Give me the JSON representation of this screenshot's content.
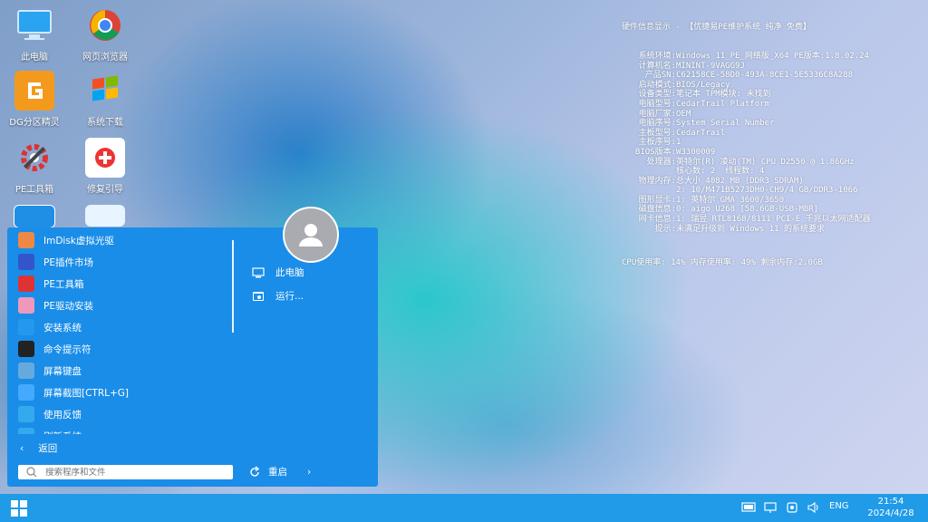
{
  "desktop": {
    "icons": [
      {
        "label": "此电脑",
        "icon": "computer-icon"
      },
      {
        "label": "网页浏览器",
        "icon": "browser-icon"
      },
      {
        "label": "DG分区精灵",
        "icon": "partition-tool-icon"
      },
      {
        "label": "系统下载",
        "icon": "windows-download-icon"
      },
      {
        "label": "PE工具箱",
        "icon": "toolbox-icon"
      },
      {
        "label": "修复引导",
        "icon": "repair-boot-icon"
      }
    ]
  },
  "hw_info": {
    "title": "硬件信息显示 - 【优捷易PE维护系统 纯净 免费】",
    "rows": [
      {
        "k": "系统环境:",
        "v": "Windows 11_PE_网络版_X64 PE版本:1.8.02.24"
      },
      {
        "k": "计算机名:",
        "v": "MININT-9VAGG9J"
      },
      {
        "k": "产品SN:",
        "v": "C62158CE-58D0-493A-8CE1-5E5336C8A288"
      },
      {
        "k": "启动模式:",
        "v": "BIOS/Legacy"
      },
      {
        "k": "设备类型:",
        "v": "笔记本 TPM模块: 未找到"
      },
      {
        "k": "电脑型号:",
        "v": "CedarTrail Platform"
      },
      {
        "k": "电脑厂家:",
        "v": "OEM"
      },
      {
        "k": "电脑序号:",
        "v": "System Serial Number"
      },
      {
        "k": "主板型号:",
        "v": "CedarTrail"
      },
      {
        "k": "主板序号:",
        "v": "1"
      },
      {
        "k": "BIOS版本:",
        "v": "W3300009"
      },
      {
        "k": "处理器:",
        "v": "英特尔(R) 凌动(TM) CPU D2550 @ 1.86GHz"
      },
      {
        "k": "",
        "v": "核心数: 2  线程数: 4"
      },
      {
        "k": "物理内存:",
        "v": "总大小 4082 MB (DDR3 SDRAM)"
      },
      {
        "k": "",
        "v": "2: 10/M471B5273DH0-CH9/4 GB/DDR3-1066"
      },
      {
        "k": "图形显卡:",
        "v": "1: 英特尔 GMA 3600/3650"
      },
      {
        "k": "磁盘信息:",
        "v": "0: aigo U268 [58.6GB-USB-MBR]"
      },
      {
        "k": "网卡信息:",
        "v": "1: 瑞昱 RTL8168/8111 PCI-E 千兆以太网适配器"
      },
      {
        "k": "提示:",
        "v": "未满足升级到 Windows 11 的系统要求"
      }
    ],
    "usage": "CPU使用率: 14% 内存使用率: 49% 剩余内存:2.0GB"
  },
  "start_menu": {
    "apps": [
      {
        "label": "ImDisk虚拟光驱",
        "icon": "imdisk-icon"
      },
      {
        "label": "PE插件市场",
        "icon": "plugin-market-icon"
      },
      {
        "label": "PE工具箱",
        "icon": "toolbox-icon"
      },
      {
        "label": "PE驱动安装",
        "icon": "driver-install-icon"
      },
      {
        "label": "安装系统",
        "icon": "install-system-icon"
      },
      {
        "label": "命令提示符",
        "icon": "cmd-icon"
      },
      {
        "label": "屏幕键盘",
        "icon": "keyboard-icon"
      },
      {
        "label": "屏幕截图[CTRL+G]",
        "icon": "screenshot-icon"
      },
      {
        "label": "使用反馈",
        "icon": "feedback-icon"
      },
      {
        "label": "刷新系统",
        "icon": "refresh-icon"
      }
    ],
    "right_links": [
      {
        "label": "此电脑",
        "icon": "computer-icon"
      },
      {
        "label": "运行...",
        "icon": "run-icon"
      }
    ],
    "back_label": "返回",
    "search_placeholder": "搜索程序和文件",
    "restart_label": "重启"
  },
  "taskbar": {
    "language": "ENG",
    "time": "21:54",
    "date": "2024/4/28"
  },
  "colors": {
    "menu_bg": "#1a8de8",
    "taskbar_bg": "#1f9be8",
    "accent": "#0078d4"
  }
}
